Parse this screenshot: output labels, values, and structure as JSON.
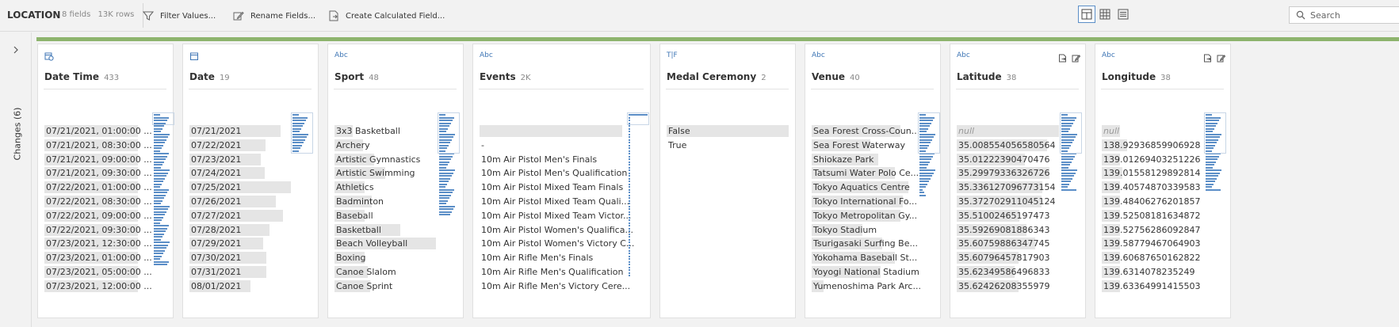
{
  "toolbar": {
    "title": "LOCATION",
    "field_count": "8 fields",
    "row_count": "13K rows",
    "buttons": [
      {
        "label": "Filter Values...",
        "icon": "filter-icon"
      },
      {
        "label": "Rename Fields...",
        "icon": "rename-icon"
      },
      {
        "label": "Create Calculated Field...",
        "icon": "calculated-field-icon"
      }
    ],
    "views": [
      "profile-view-icon",
      "data-grid-view-icon",
      "list-view-icon"
    ],
    "search_placeholder": "Search"
  },
  "changes_panel": {
    "label": "Changes (6)"
  },
  "accent_colors": {
    "progress_bar": "#8db46d",
    "type_icon": "#3f76b5",
    "spark": "#5b8ec7"
  },
  "columns": [
    {
      "name": "Date Time",
      "type_label": "",
      "type_icon": "datetime-type-icon",
      "count": "433",
      "values": [
        "07/21/2021, 01:00:00 ...",
        "07/21/2021, 08:30:00 ...",
        "07/21/2021, 09:00:00 ...",
        "07/21/2021, 09:30:00 ...",
        "07/22/2021, 01:00:00 ...",
        "07/22/2021, 08:30:00 ...",
        "07/22/2021, 09:00:00 ...",
        "07/22/2021, 09:30:00 ...",
        "07/23/2021, 12:30:00 ...",
        "07/23/2021, 01:00:00 ...",
        "07/23/2021, 05:00:00 ...",
        "07/23/2021, 12:00:00 ..."
      ],
      "bar_fractions": [
        0.98,
        0.98,
        0.98,
        0.98,
        0.98,
        0.98,
        0.98,
        0.98,
        0.98,
        0.98,
        0.98,
        0.98
      ]
    },
    {
      "name": "Date",
      "type_label": "",
      "type_icon": "date-type-icon",
      "count": "19",
      "values": [
        "07/21/2021",
        "07/22/2021",
        "07/23/2021",
        "07/24/2021",
        "07/25/2021",
        "07/26/2021",
        "07/27/2021",
        "07/28/2021",
        "07/29/2021",
        "07/30/2021",
        "07/31/2021",
        "08/01/2021"
      ],
      "bar_fractions": [
        0.9,
        0.75,
        0.7,
        0.74,
        1.0,
        0.85,
        0.92,
        0.79,
        0.73,
        0.76,
        0.76,
        0.6
      ]
    },
    {
      "name": "Sport",
      "type_label": "Abc",
      "type_icon": "string-type-icon",
      "count": "48",
      "values": [
        "3x3 Basketball",
        "Archery",
        "Artistic Gymnastics",
        "Artistic Swimming",
        "Athletics",
        "Badminton",
        "Baseball",
        "Basketball",
        "Beach Volleyball",
        "Boxing",
        "Canoe Slalom",
        "Canoe Sprint"
      ],
      "bar_fractions": [
        0.18,
        0.28,
        0.39,
        0.5,
        0.3,
        0.37,
        0.3,
        0.65,
        1.0,
        0.3,
        0.33,
        0.35
      ]
    },
    {
      "name": "Events",
      "type_label": "Abc",
      "type_icon": "string-type-icon",
      "count": "2K",
      "values": [
        "",
        "-",
        "10m Air Pistol Men's Finals",
        "10m Air Pistol Men's Qualification",
        "10m Air Pistol Mixed Team Finals",
        "10m Air Pistol Mixed Team Quali...",
        "10m Air Pistol Mixed Team Victor...",
        "10m Air Pistol Women's Qualifica...",
        "10m Air Pistol Women's Victory C...",
        "10m Air Rifle Men's Finals",
        "10m Air Rifle Men's Qualification",
        "10m Air Rifle Men's Victory Cere..."
      ],
      "bar_fractions": [
        1.0,
        0,
        0,
        0,
        0,
        0,
        0,
        0,
        0,
        0,
        0,
        0
      ]
    },
    {
      "name": "Medal Ceremony",
      "type_label": "T|F",
      "type_icon": "boolean-type-icon",
      "count": "2",
      "values": [
        "False",
        "True"
      ],
      "bar_fractions": [
        1.0,
        0
      ]
    },
    {
      "name": "Venue",
      "type_label": "Abc",
      "type_icon": "string-type-icon",
      "count": "40",
      "values": [
        "Sea Forest Cross-Coun...",
        "Sea Forest Waterway",
        "Shiokaze Park",
        "Tatsumi Water Polo Ce...",
        "Tokyo Aquatics Centre",
        "Tokyo International Fo...",
        "Tokyo Metropolitan Gy...",
        "Tokyo Stadium",
        "Tsurigasaki Surfing Be...",
        "Yokohama Baseball St...",
        "Yoyogi National Stadium",
        "Yumenoshima Park Arc..."
      ],
      "bar_fractions": [
        0.9,
        0.6,
        0.68,
        0.85,
        0.98,
        0.93,
        0.9,
        0.52,
        0.72,
        0.85,
        0.7,
        0.12
      ]
    },
    {
      "name": "Latitude",
      "type_label": "Abc",
      "type_icon": "string-type-icon",
      "count": "38",
      "values": [
        "null",
        "35.008554056580564",
        "35.01222390470476",
        "35.29979336326726",
        "35.336127096773154",
        "35.372702911045124",
        "35.51002465197473",
        "35.59269081886343",
        "35.60759886347745",
        "35.60796457817903",
        "35.62349586496833",
        "35.62426208355979"
      ],
      "bar_fractions": [
        0.99,
        0.88,
        0.66,
        0.9,
        0.83,
        0.82,
        0.61,
        0.68,
        0.76,
        0.6,
        0.56,
        0.6
      ]
    },
    {
      "name": "Longitude",
      "type_label": "Abc",
      "type_icon": "string-type-icon",
      "count": "38",
      "values": [
        "null",
        "138.92936859906928",
        "139.01269403251226",
        "139.01558129892814",
        "139.40574870339583",
        "139.48406276201857",
        "139.52508181634872",
        "139.52756286092847",
        "139.58779467064903",
        "139.60687650162822",
        "139.6314078235249",
        "139.63364991415503"
      ],
      "bar_fractions": [
        0.2,
        0.28,
        0.2,
        0.22,
        0.2,
        0.2,
        0.2,
        0.2,
        0.2,
        0.2,
        0.2,
        0.2
      ]
    }
  ]
}
